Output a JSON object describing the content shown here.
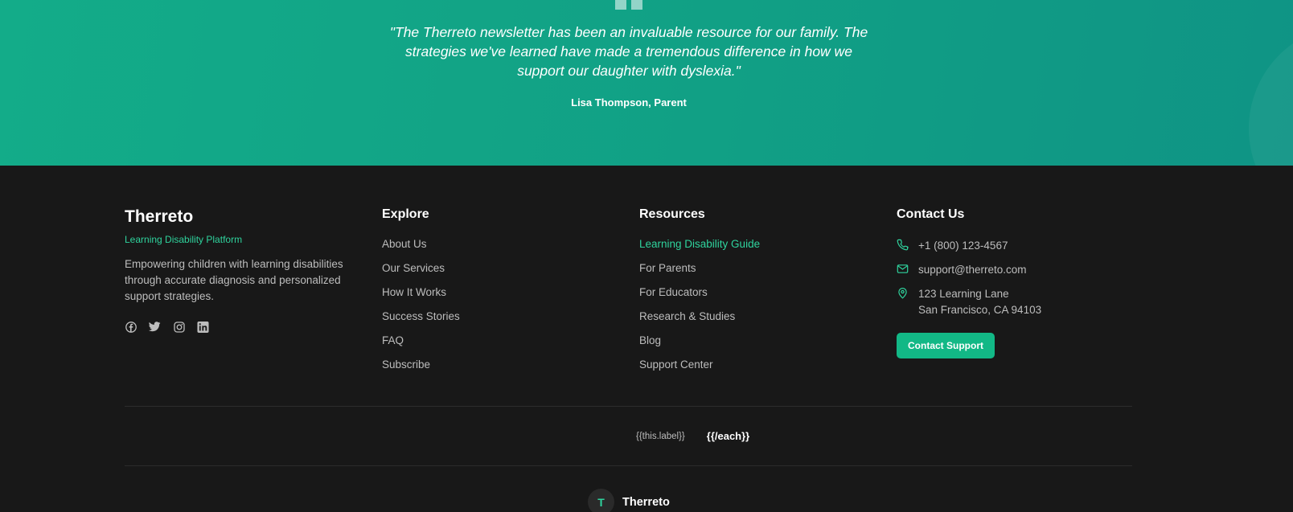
{
  "testimonial": {
    "quote": "\"The Therreto newsletter has been an invaluable resource for our family. The strategies we've learned have made a tremendous difference in how we support our daughter with dyslexia.\"",
    "author": "Lisa Thompson, Parent"
  },
  "brand": {
    "name": "Therreto",
    "tagline": "Learning Disability Platform",
    "description": "Empowering children with learning disabilities through accurate diagnosis and personalized support strategies.",
    "socials": [
      "facebook-icon",
      "twitter-icon",
      "instagram-icon",
      "linkedin-icon"
    ]
  },
  "explore": {
    "title": "Explore",
    "links": [
      "About Us",
      "Our Services",
      "How It Works",
      "Success Stories",
      "FAQ",
      "Subscribe"
    ]
  },
  "resources": {
    "title": "Resources",
    "links": [
      "Learning Disability Guide",
      "For Parents",
      "For Educators",
      "Research & Studies",
      "Blog",
      "Support Center"
    ]
  },
  "contact": {
    "title": "Contact Us",
    "phone": "+1 (800) 123-4567",
    "email": "support@therreto.com",
    "address_line1": "123 Learning Lane",
    "address_line2": "San Francisco, CA 94103",
    "button": "Contact Support"
  },
  "bottom_nav": {
    "item_template": "{{this.label}}",
    "each_close": "{{/each}}"
  },
  "bottom_brand": {
    "logo_letter": "T",
    "name": "Therreto"
  },
  "colors": {
    "accent": "#2fd39d",
    "button": "#12b886",
    "footer_bg": "#181818",
    "band_bg": "#11a085"
  }
}
